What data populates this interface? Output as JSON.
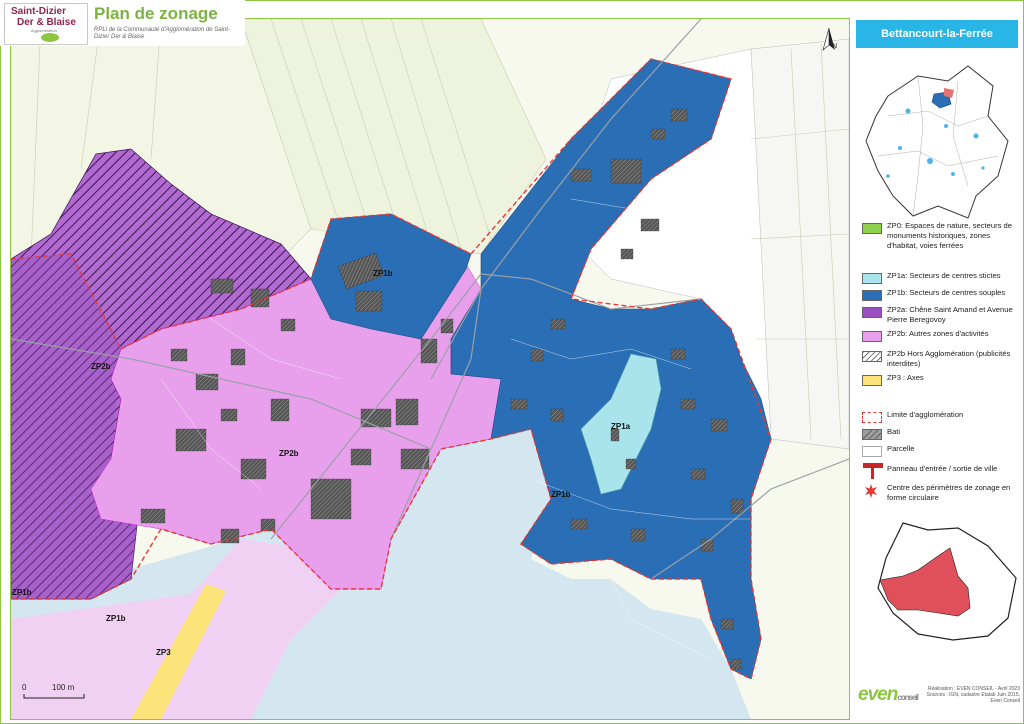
{
  "header": {
    "logo_line1": "Saint-Dizier",
    "logo_line2": "Der & Blaise",
    "logo_line3": "Agglomération",
    "title": "Plan de zonage",
    "subtitle": "RPLi de la Communauté d'Agglomération de Saint-Dizier Der & Blaise"
  },
  "map": {
    "north_label": "N",
    "scale_zero": "0",
    "scale_label": "100 m",
    "zone_labels": [
      "ZP1b",
      "ZP2b",
      "ZP2b",
      "ZP1a",
      "ZP1b",
      "ZP1b",
      "ZP1b",
      "ZP3"
    ],
    "colors": {
      "zp0": "#8fd14f",
      "zp1a": "#a9e4ec",
      "zp1b": "#2a6fb5",
      "zp2a": "#9b4fc0",
      "zp2b": "#e9a0ec",
      "zp3": "#fbe37a",
      "limit": "#e53935"
    }
  },
  "sidebar": {
    "commune": "Bettancourt-la-Ferrée",
    "legend": [
      {
        "key": "zp0",
        "label": "ZP0: Espaces de nature, secteurs de monuments historiques, zones d'habitat, voies ferrées",
        "color": "#8fd14f"
      },
      {
        "key": "zp1a",
        "label": "ZP1a: Secteurs de centres stictes",
        "color": "#a9e4ec"
      },
      {
        "key": "zp1b",
        "label": "ZP1b: Secteurs de centres souples",
        "color": "#2a6fb5"
      },
      {
        "key": "zp2a",
        "label": "ZP2a: Chêne Saint Amand et Avenue Pierre Beregovoy",
        "color": "#9b4fc0"
      },
      {
        "key": "zp2b",
        "label": "ZP2b: Autres zones d'activités",
        "color": "#e9a0ec"
      },
      {
        "key": "zp2b_hors",
        "label": "ZP2b Hors Agglomération (publicités interdites)",
        "color": "#ffffff"
      },
      {
        "key": "zp3",
        "label": "ZP3 : Axes",
        "color": "#fbe37a"
      },
      {
        "key": "limite",
        "label": "Limite d'agglomération",
        "color": "#e53935"
      },
      {
        "key": "bati",
        "label": "Bati",
        "color": "#9e9e9e"
      },
      {
        "key": "parcelle",
        "label": "Parcelle",
        "color": "#ffffff"
      },
      {
        "key": "panneau",
        "label": "Panneau d'entrée / sortie de ville",
        "color": "#c62828"
      },
      {
        "key": "centre",
        "label": "Centre des périmètres de zonage en forme circulaire",
        "color": "#e53935"
      }
    ]
  },
  "footer": {
    "credits_line1": "Réalisation : EVEN CONSEIL - Avril 2023",
    "credits_line2": "Sources : IGN, cadastre Etalab Juin 2015,",
    "credits_line3": "Even Conseil",
    "brand": "even",
    "brand_sub": "conseil"
  }
}
